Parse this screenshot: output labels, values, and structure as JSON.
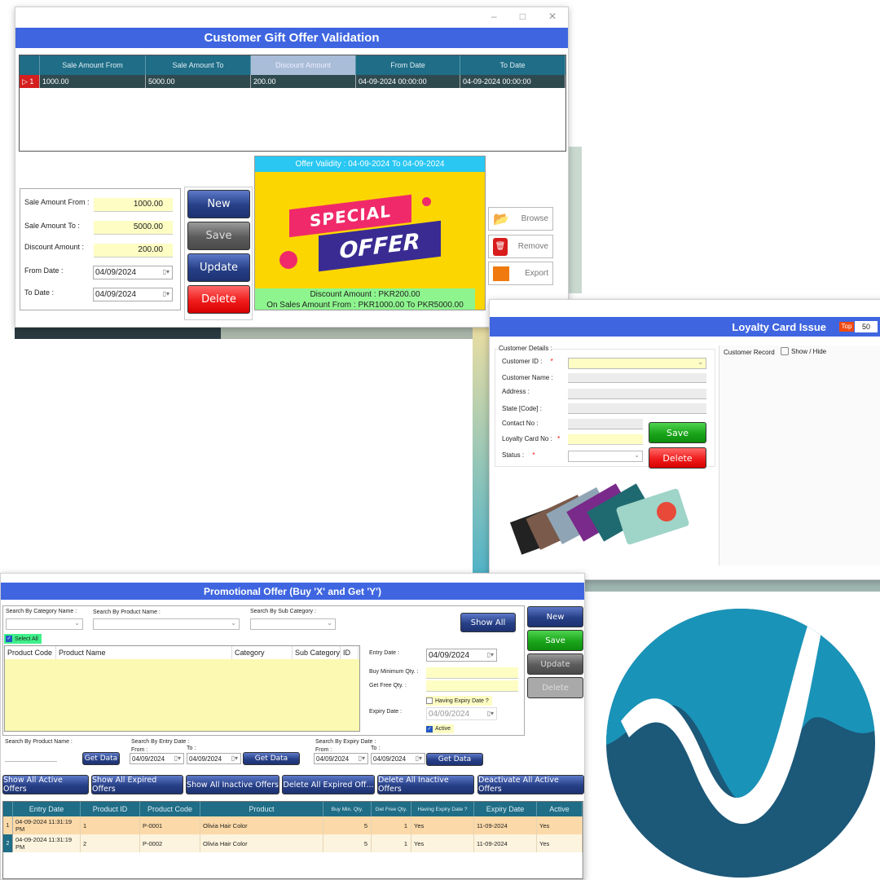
{
  "gift_window": {
    "title": "Customer Gift Offer Validation",
    "columns": [
      "Sale Amount From",
      "Sale Amount To",
      "Discount Amount",
      "From Date",
      "To Date"
    ],
    "rows": [
      {
        "row_no": "1",
        "cells": [
          "1000.00",
          "5000.00",
          "200.00",
          "04-09-2024 00:00:00",
          "04-09-2024 00:00:00"
        ]
      }
    ],
    "form": {
      "sale_from_label": "Sale Amount From :",
      "sale_from": "1000.00",
      "sale_to_label": "Sale Amount To :",
      "sale_to": "5000.00",
      "discount_label": "Discount Amount :",
      "discount": "200.00",
      "from_date_label": "From Date :",
      "from_date": "04/09/2024",
      "to_date_label": "To Date :",
      "to_date": "04/09/2024"
    },
    "buttons": {
      "new": "New",
      "save": "Save",
      "update": "Update",
      "delete": "Delete"
    },
    "offer": {
      "validity": "Offer Validity : 04-09-2024 To 04-09-2024",
      "special": "SPECIAL",
      "offer": "OFFER",
      "discount_line": "Discount Amount : PKR200.00",
      "sales_line": "On Sales Amount From : PKR1000.00 To PKR5000.00"
    },
    "side_buttons": {
      "browse": "Browse",
      "remove": "Remove",
      "export": "Export"
    }
  },
  "loyalty_window": {
    "title": "Loyalty Card Issue",
    "top_label": "Top",
    "top_value": "50",
    "group_label": "Customer Details :",
    "labels": {
      "customer_id": "Customer ID :",
      "customer_name": "Customer Name :",
      "address": "Address :",
      "state": "State [Code] :",
      "contact": "Contact No :",
      "card_no": "Loyalty Card No :",
      "status": "Status :"
    },
    "required_mark": "*",
    "buttons": {
      "save": "Save",
      "delete": "Delete"
    },
    "customer_record_label": "Customer Record",
    "show_hide_label": "Show / Hide"
  },
  "promo_window": {
    "title": "Promotional Offer  (Buy 'X' and Get 'Y')",
    "search_category_label": "Search By Category Name :",
    "search_product_label": "Search By Product Name :",
    "search_subcategory_label": "Search By Sub Category :",
    "show_all": "Show All",
    "select_all": "Select All",
    "product_columns": [
      "Product Code",
      "Product Name",
      "Category",
      "Sub Category",
      "ID"
    ],
    "entry_date_label": "Entry Date :",
    "entry_date": "04/09/2024",
    "buy_min_label": "Buy Minimum Qty. :",
    "get_free_label": "Get Free Qty. :",
    "having_expiry_label": "Having Expiry Date ?",
    "expiry_date_label": "Expiry Date :",
    "expiry_date": "04/09/2024",
    "active_label": "Active",
    "buttons": {
      "new": "New",
      "save": "Save",
      "update": "Update",
      "delete": "Delete"
    },
    "search_by_product_name": "Search By Product Name :",
    "search_by_entry_date": "Search By Entry Date :",
    "search_by_expiry_date": "Search By Expiry Date :",
    "from_label": "From :",
    "to_label": "To :",
    "entry_from": "04/09/2024",
    "entry_to": "04/09/2024",
    "expiry_from": "04/09/2024",
    "expiry_to": "04/09/2024",
    "get_data": "Get Data",
    "action_buttons": [
      "Show All Active Offers",
      "Show All Expired Offers",
      "Show All Inactive Offers",
      "Delete All Expired Off...",
      "Delete All Inactive Offers",
      "Deactivate All Active Offers"
    ],
    "offer_columns": [
      "Entry Date",
      "Product ID",
      "Product Code",
      "Product",
      "Buy Min. Qty.",
      "Get Free Qty.",
      "Having Expiry Date ?",
      "Expiry Date",
      "Active"
    ],
    "offer_rows": [
      {
        "row_no": "1",
        "cells": [
          "04-09-2024 11:31:19 PM",
          "1",
          "P-0001",
          "Olivia Hair Color",
          "5",
          "1",
          "Yes",
          "11-09-2024",
          "Yes"
        ]
      },
      {
        "row_no": "2",
        "cells": [
          "04-09-2024 11:31:19 PM",
          "2",
          "P-0002",
          "Olivia Hair Color",
          "5",
          "1",
          "Yes",
          "11-09-2024",
          "Yes"
        ]
      }
    ]
  },
  "colors": {
    "header_blue": "#3f66e0",
    "grid_teal": "#1f6d86",
    "input_yellow": "#fdfdc4",
    "logo_teal": "#1a93b8",
    "logo_dark": "#1c5878"
  }
}
